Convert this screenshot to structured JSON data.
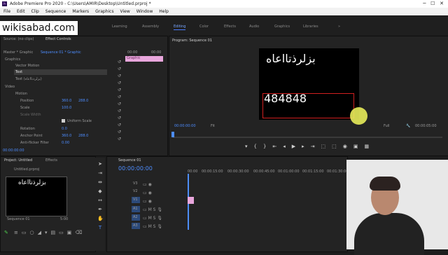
{
  "window": {
    "title": "Adobe Premiere Pro 2020 - C:\\Users\\AMIR\\Desktop\\Untitled.prproj *",
    "app_icon": "Pr"
  },
  "menubar": [
    "File",
    "Edit",
    "Clip",
    "Sequence",
    "Markers",
    "Graphics",
    "View",
    "Window",
    "Help"
  ],
  "workspace_tabs": [
    "Learning",
    "Assembly",
    "Editing",
    "Color",
    "Effects",
    "Audio",
    "Graphics",
    "Libraries"
  ],
  "workspace_active": "Editing",
  "watermark": "wikisabad.com",
  "source_panel": {
    "tabs": [
      "Source: (no clips)",
      "Effect Controls"
    ],
    "header": "Master * Graphic",
    "header_seq": "Sequence 01 * Graphic",
    "graphic_label": "Graphic",
    "clip_label": "Graphic",
    "rows": {
      "graphics": "Graphics",
      "vector_motion": "Vector Motion",
      "text1": "Text",
      "text2": "Text (بزلرذتااعاه)",
      "video": "Video",
      "motion": "Motion",
      "position": "Position",
      "position_x": "360.0",
      "position_y": "288.0",
      "scale": "Scale",
      "scale_v": "100.0",
      "scale_width": "Scale Width",
      "uniform_scale": "Uniform Scale",
      "rotation": "Rotation",
      "rotation_v": "0.0",
      "anchor_point": "Anchor Point",
      "anchor_x": "360.0",
      "anchor_y": "288.0",
      "anti_flicker": "Anti-flicker Filter",
      "anti_flicker_v": "0.00"
    },
    "timecode_top": "00:00",
    "timecode_bottom": "00:00:00:00"
  },
  "program": {
    "title": "Program: Sequence 01",
    "text_top": "بزلرذتااعاه",
    "text_number": "484848",
    "timecode": "00:00:00:00",
    "fit": "Fit",
    "quality": "Full",
    "duration": "00:00:05:00"
  },
  "project": {
    "tabs": [
      "Project: Untitled",
      "Effects"
    ],
    "file": "Untitled.prproj",
    "thumb_text": "بزلرذتااعاه",
    "item_name": "Sequence 01",
    "item_duration": "5:00"
  },
  "timeline": {
    "title": "Sequence 01",
    "timecode": "00:00:00:00",
    "ruler": [
      "00:00",
      "00:00:15:00",
      "00:00:30:00",
      "00:00:45:00",
      "00:01:00:00",
      "00:01:15:00",
      "00:01:30:00",
      "00:01:45:00",
      "00:02:00:00",
      "00:02:15:00"
    ],
    "tracks": [
      "V3",
      "V2",
      "V1",
      "A1",
      "A2",
      "A3"
    ]
  },
  "colors": {
    "accent": "#4d8dff",
    "clip": "#e8a6dc",
    "tab_active": "#7aa7ff"
  }
}
